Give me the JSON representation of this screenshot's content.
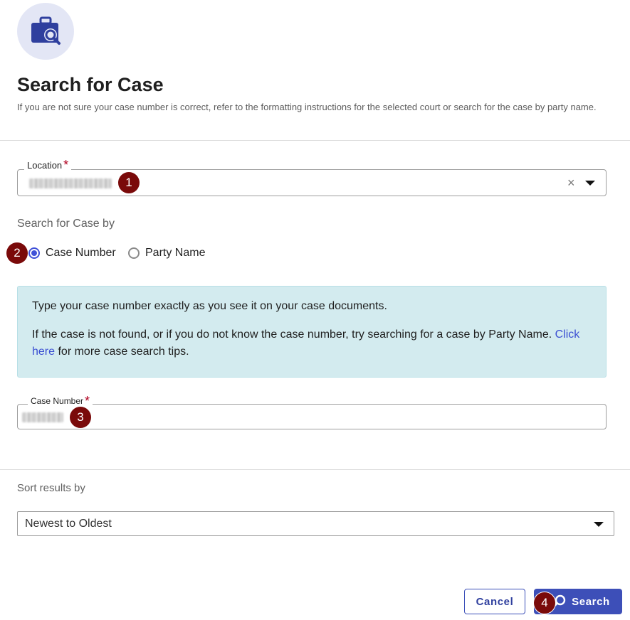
{
  "header": {
    "icon": "briefcase-search-icon",
    "title": "Search for Case",
    "subtitle": "If you are not sure your case number is correct, refer to the formatting instructions for the selected court or search for the case by party name."
  },
  "location": {
    "label": "Location",
    "required_mark": "*",
    "clear_icon": "×",
    "step": "1"
  },
  "search_by": {
    "label": "Search for Case by",
    "options": [
      "Case Number",
      "Party Name"
    ],
    "selected": "Case Number",
    "step": "2"
  },
  "info": {
    "line1": "Type your case number exactly as you see it on your case documents.",
    "line2_before": "If the case is not found, or if you do not know the case number, try searching for a case by Party Name. ",
    "link": "Click here",
    "line2_after": " for more case search tips."
  },
  "case_number": {
    "label": "Case Number",
    "required_mark": "*",
    "step": "3"
  },
  "sort": {
    "label": "Sort results by",
    "value": "Newest to Oldest"
  },
  "actions": {
    "cancel": "Cancel",
    "search": "Search",
    "step": "4"
  },
  "colors": {
    "primary": "#3d4fb8",
    "info_bg": "#d3ebef",
    "step_badge": "#7a0a0a",
    "required": "#b00020"
  }
}
